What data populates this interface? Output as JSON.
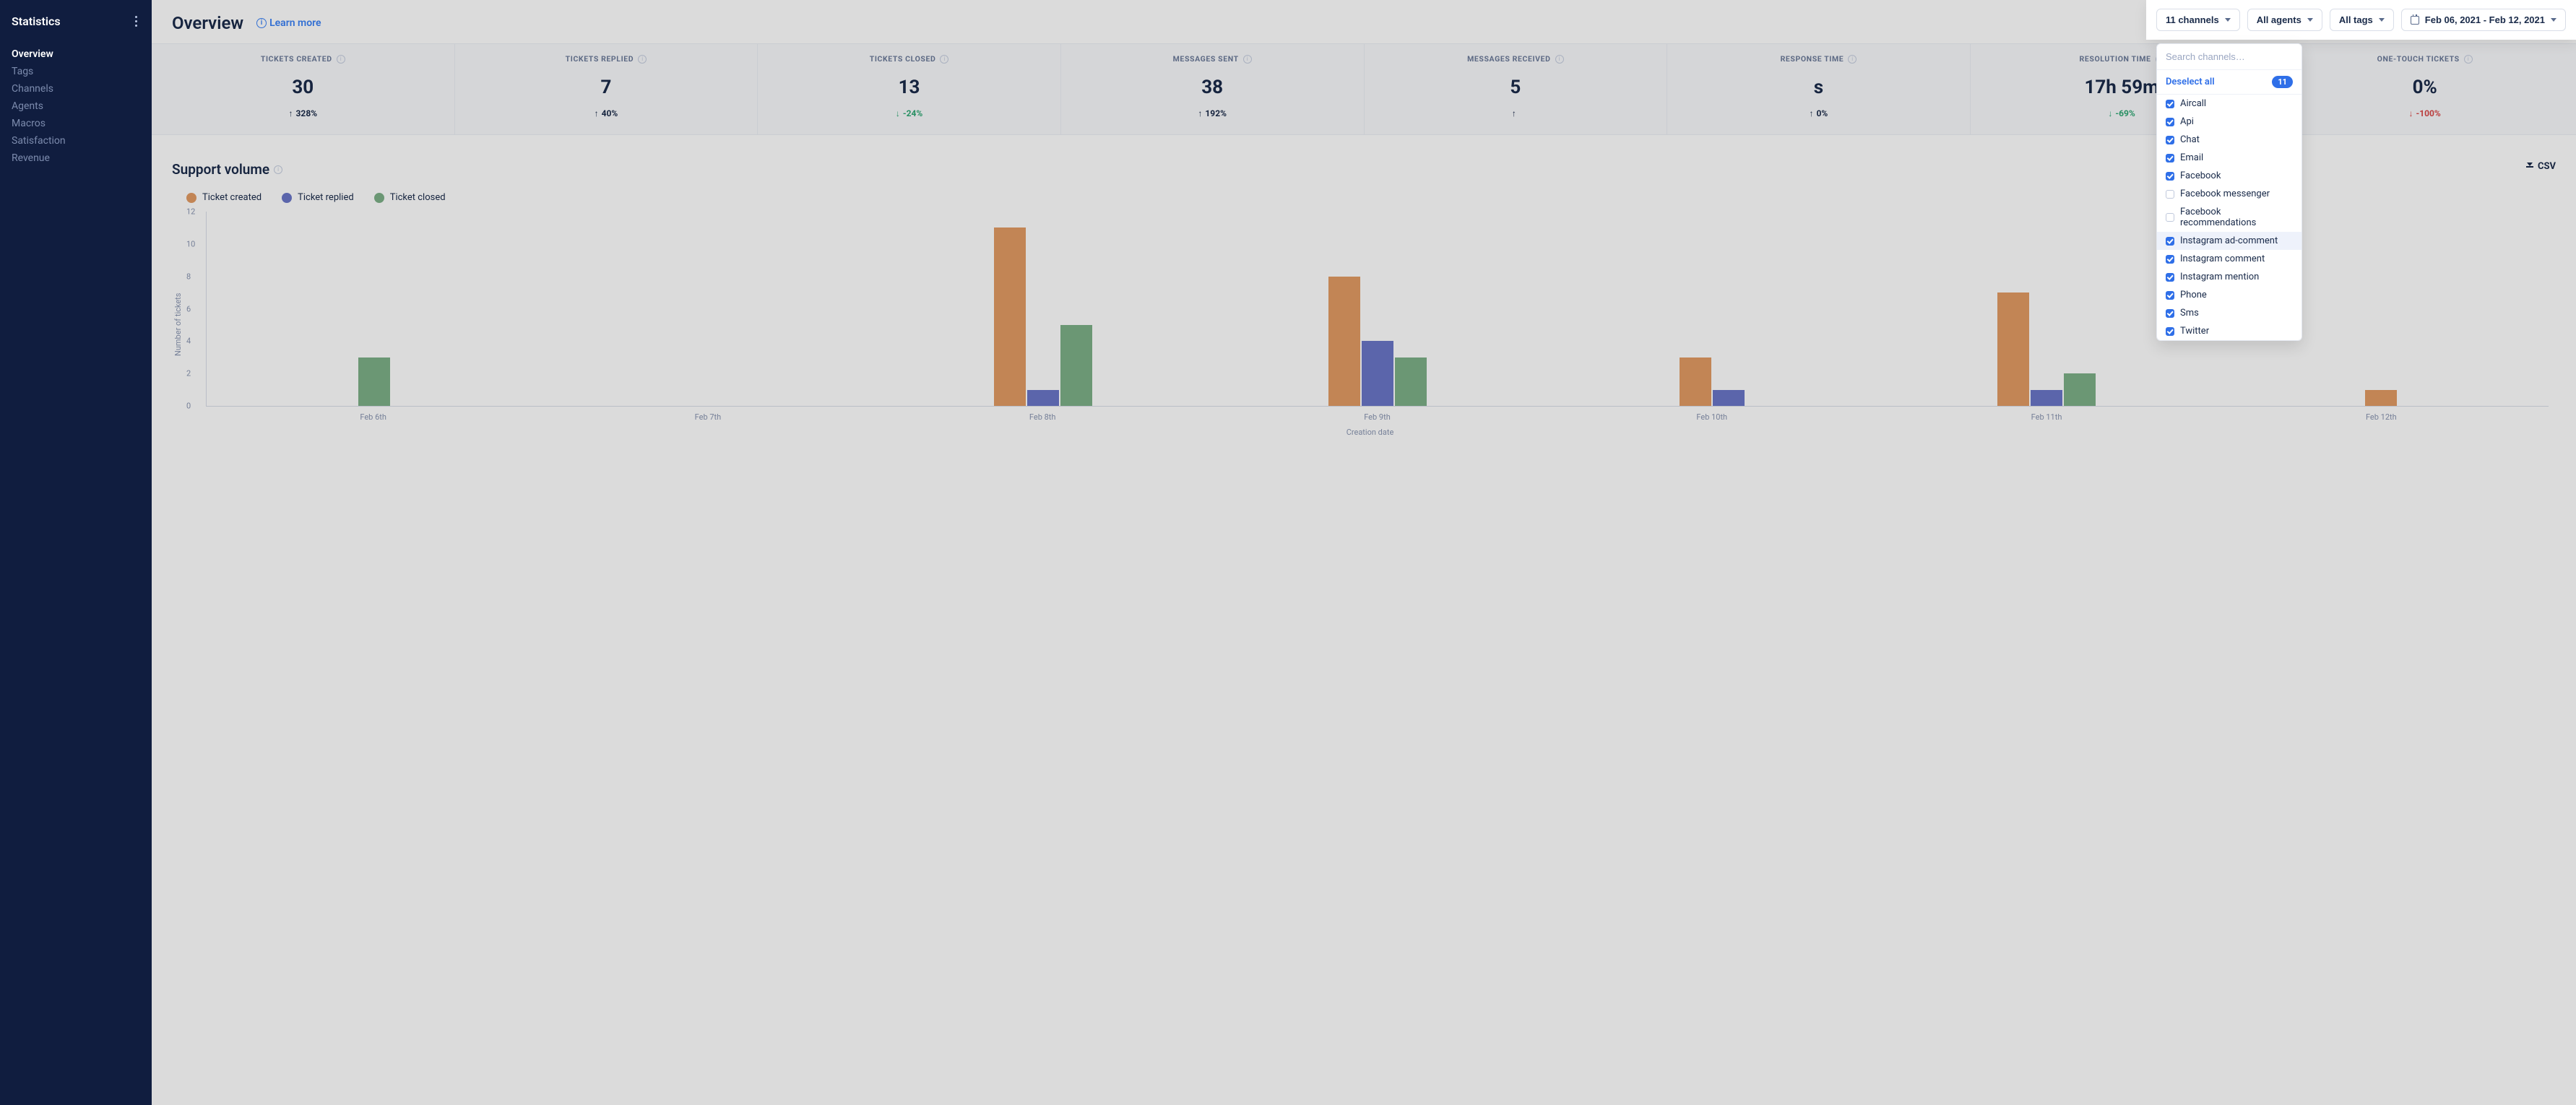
{
  "sidebar": {
    "title": "Statistics",
    "items": [
      {
        "label": "Overview",
        "active": true
      },
      {
        "label": "Tags",
        "active": false
      },
      {
        "label": "Channels",
        "active": false
      },
      {
        "label": "Agents",
        "active": false
      },
      {
        "label": "Macros",
        "active": false
      },
      {
        "label": "Satisfaction",
        "active": false
      },
      {
        "label": "Revenue",
        "active": false
      }
    ]
  },
  "page": {
    "title": "Overview",
    "learn_more": "Learn more"
  },
  "filters": {
    "channels_label": "11 channels",
    "agents_label": "All agents",
    "tags_label": "All tags",
    "date_range": "Feb 06, 2021 - Feb 12, 2021"
  },
  "channels_dropdown": {
    "search_placeholder": "Search channels…",
    "deselect_label": "Deselect all",
    "count": "11",
    "items": [
      {
        "label": "Aircall",
        "checked": true,
        "highlight": false
      },
      {
        "label": "Api",
        "checked": true,
        "highlight": false
      },
      {
        "label": "Chat",
        "checked": true,
        "highlight": false
      },
      {
        "label": "Email",
        "checked": true,
        "highlight": false
      },
      {
        "label": "Facebook",
        "checked": true,
        "highlight": false
      },
      {
        "label": "Facebook messenger",
        "checked": false,
        "highlight": false
      },
      {
        "label": "Facebook recommendations",
        "checked": false,
        "highlight": false
      },
      {
        "label": "Instagram ad-comment",
        "checked": true,
        "highlight": true
      },
      {
        "label": "Instagram comment",
        "checked": true,
        "highlight": false
      },
      {
        "label": "Instagram mention",
        "checked": true,
        "highlight": false
      },
      {
        "label": "Phone",
        "checked": true,
        "highlight": false
      },
      {
        "label": "Sms",
        "checked": true,
        "highlight": false
      },
      {
        "label": "Twitter",
        "checked": true,
        "highlight": false
      }
    ]
  },
  "kpis": [
    {
      "label": "TICKETS CREATED",
      "value": "30",
      "delta": "328%",
      "dir": "up"
    },
    {
      "label": "TICKETS REPLIED",
      "value": "7",
      "delta": "40%",
      "dir": "up"
    },
    {
      "label": "TICKETS CLOSED",
      "value": "13",
      "delta": "-24%",
      "dir": "down-green"
    },
    {
      "label": "MESSAGES SENT",
      "value": "38",
      "delta": "192%",
      "dir": "up"
    },
    {
      "label": "MESSAGES RECEIVED",
      "value": "5",
      "delta": "",
      "dir": "up"
    },
    {
      "label": "RESPONSE TIME",
      "value": "s",
      "delta": "0%",
      "dir": "up"
    },
    {
      "label": "RESOLUTION TIME",
      "value": "17h 59m",
      "delta": "-69%",
      "dir": "down-green"
    },
    {
      "label": "ONE-TOUCH TICKETS",
      "value": "0%",
      "delta": "-100%",
      "dir": "down-red"
    }
  ],
  "section": {
    "title": "Support volume",
    "csv_label": "CSV"
  },
  "legend": {
    "created": "Ticket created",
    "replied": "Ticket replied",
    "closed": "Ticket closed"
  },
  "chart_data": {
    "type": "bar",
    "title": "Support volume",
    "xlabel": "Creation date",
    "ylabel": "Number of tickets",
    "ylim": [
      0,
      12
    ],
    "yticks": [
      0,
      2,
      4,
      6,
      8,
      10,
      12
    ],
    "categories": [
      "Feb 6th",
      "Feb 7th",
      "Feb 8th",
      "Feb 9th",
      "Feb 10th",
      "Feb 11th",
      "Feb 12th"
    ],
    "series": [
      {
        "name": "Ticket created",
        "color": "#e29b64",
        "values": [
          0,
          0,
          11,
          8,
          3,
          7,
          1
        ]
      },
      {
        "name": "Ticket replied",
        "color": "#6b76c8",
        "values": [
          0,
          0,
          1,
          4,
          1,
          1,
          0
        ]
      },
      {
        "name": "Ticket closed",
        "color": "#7db088",
        "values": [
          3,
          0,
          5,
          3,
          0,
          2,
          0
        ]
      }
    ]
  }
}
